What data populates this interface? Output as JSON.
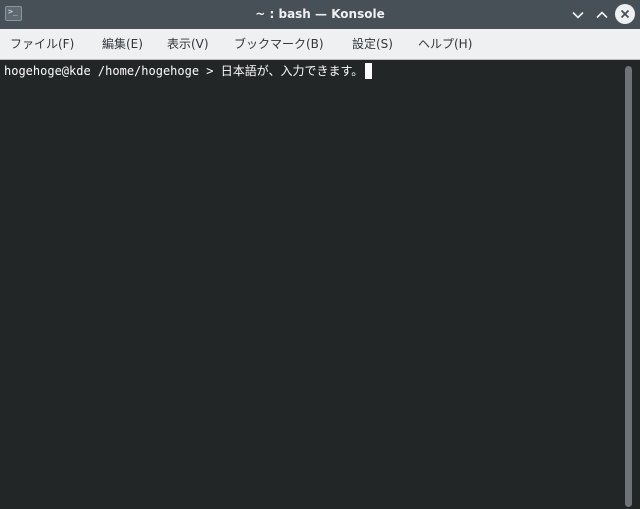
{
  "window": {
    "title": "~ : bash — Konsole",
    "app_icon_glyph": ">_",
    "colors": {
      "titlebar_bg": "#475057",
      "menubar_bg": "#eff0f1",
      "terminal_bg": "#232627",
      "terminal_fg": "#fcfcfc"
    }
  },
  "titlebar_buttons": {
    "minimize_icon": "chevron-down-icon",
    "maximize_icon": "chevron-up-icon",
    "close_icon": "close-icon"
  },
  "menu": {
    "items": [
      {
        "label": "ファイル(F)"
      },
      {
        "label": "編集(E)"
      },
      {
        "label": "表示(V)"
      },
      {
        "label": "ブックマーク(B)"
      },
      {
        "label": "設定(S)"
      },
      {
        "label": "ヘルプ(H)"
      }
    ]
  },
  "terminal": {
    "prompt": "hogehoge@kde /home/hogehoge > ",
    "input": "日本語が、入力できます。"
  }
}
